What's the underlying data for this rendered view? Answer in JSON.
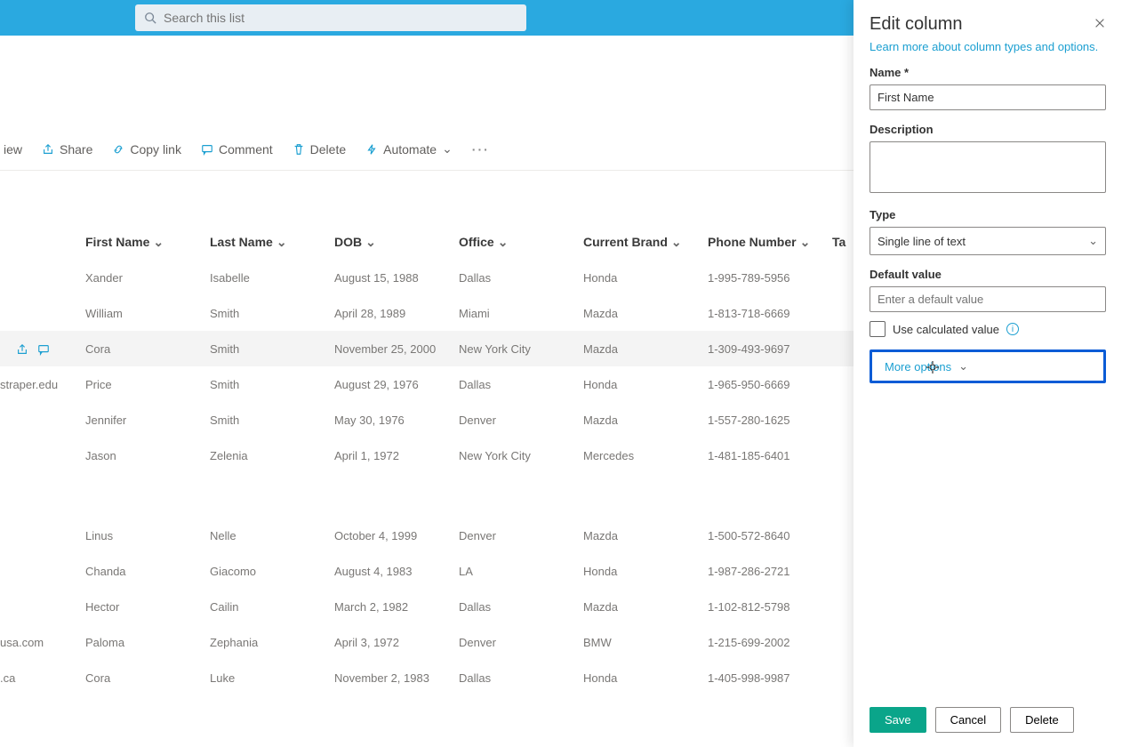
{
  "search": {
    "placeholder": "Search this list"
  },
  "toolbar": {
    "view": "iew",
    "share": "Share",
    "copylink": "Copy link",
    "comment": "Comment",
    "delete": "Delete",
    "automate": "Automate"
  },
  "columns": {
    "first": "First Name",
    "last": "Last Name",
    "dob": "DOB",
    "office": "Office",
    "brand": "Current Brand",
    "phone": "Phone Number",
    "tags": "Ta"
  },
  "rows": [
    {
      "first": "Xander",
      "last": "Isabelle",
      "dob": "August 15, 1988",
      "office": "Dallas",
      "brand": "Honda",
      "phone": "1-995-789-5956",
      "extra": ""
    },
    {
      "first": "William",
      "last": "Smith",
      "dob": "April 28, 1989",
      "office": "Miami",
      "brand": "Mazda",
      "phone": "1-813-718-6669",
      "extra": ""
    },
    {
      "first": "Cora",
      "last": "Smith",
      "dob": "November 25, 2000",
      "office": "New York City",
      "brand": "Mazda",
      "phone": "1-309-493-9697",
      "extra": "",
      "selected": true
    },
    {
      "first": "Price",
      "last": "Smith",
      "dob": "August 29, 1976",
      "office": "Dallas",
      "brand": "Honda",
      "phone": "1-965-950-6669",
      "extra": "straper.edu"
    },
    {
      "first": "Jennifer",
      "last": "Smith",
      "dob": "May 30, 1976",
      "office": "Denver",
      "brand": "Mazda",
      "phone": "1-557-280-1625",
      "extra": ""
    },
    {
      "first": "Jason",
      "last": "Zelenia",
      "dob": "April 1, 1972",
      "office": "New York City",
      "brand": "Mercedes",
      "phone": "1-481-185-6401",
      "extra": ""
    }
  ],
  "rows2": [
    {
      "first": "Linus",
      "last": "Nelle",
      "dob": "October 4, 1999",
      "office": "Denver",
      "brand": "Mazda",
      "phone": "1-500-572-8640",
      "extra": ""
    },
    {
      "first": "Chanda",
      "last": "Giacomo",
      "dob": "August 4, 1983",
      "office": "LA",
      "brand": "Honda",
      "phone": "1-987-286-2721",
      "extra": ""
    },
    {
      "first": "Hector",
      "last": "Cailin",
      "dob": "March 2, 1982",
      "office": "Dallas",
      "brand": "Mazda",
      "phone": "1-102-812-5798",
      "extra": ""
    },
    {
      "first": "Paloma",
      "last": "Zephania",
      "dob": "April 3, 1972",
      "office": "Denver",
      "brand": "BMW",
      "phone": "1-215-699-2002",
      "extra": "usa.com"
    },
    {
      "first": "Cora",
      "last": "Luke",
      "dob": "November 2, 1983",
      "office": "Dallas",
      "brand": "Honda",
      "phone": "1-405-998-9987",
      "extra": ".ca"
    }
  ],
  "panel": {
    "title": "Edit column",
    "link": "Learn more about column types and options.",
    "name_label": "Name *",
    "name_value": "First Name",
    "desc_label": "Description",
    "type_label": "Type",
    "type_value": "Single line of text",
    "default_label": "Default value",
    "default_placeholder": "Enter a default value",
    "calc_label": "Use calculated value",
    "more": "More options",
    "save": "Save",
    "cancel": "Cancel",
    "delete": "Delete"
  }
}
